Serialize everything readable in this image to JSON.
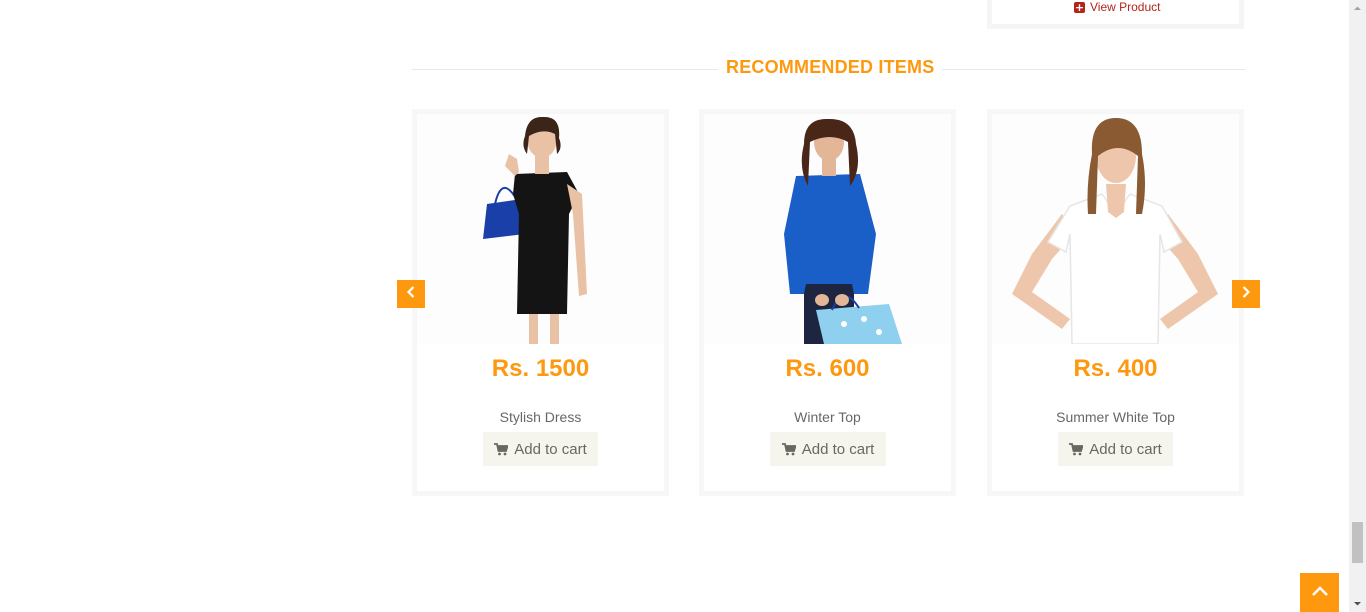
{
  "top_card": {
    "view_product": "View Product"
  },
  "section": {
    "title": "RECOMMENDED ITEMS"
  },
  "products": [
    {
      "price": "Rs. 1500",
      "name": "Stylish Dress",
      "button": "Add to cart",
      "image": "woman in black dress with shopping bag"
    },
    {
      "price": "Rs. 600",
      "name": "Winter Top",
      "button": "Add to cart",
      "image": "woman in blue top holding shopping bag"
    },
    {
      "price": "Rs. 400",
      "name": "Summer White Top",
      "button": "Add to cart",
      "image": "woman in white t-shirt"
    }
  ],
  "icons": {
    "carousel_left": "chevron-left-icon",
    "carousel_right": "chevron-right-icon",
    "cart": "shopping-cart-icon",
    "view_product": "plus-square-icon",
    "scroll_top": "chevron-up-icon"
  },
  "colors": {
    "accent": "#fe980f",
    "text": "#696763",
    "link": "#b4241b",
    "button_bg": "#f5f5ed"
  }
}
